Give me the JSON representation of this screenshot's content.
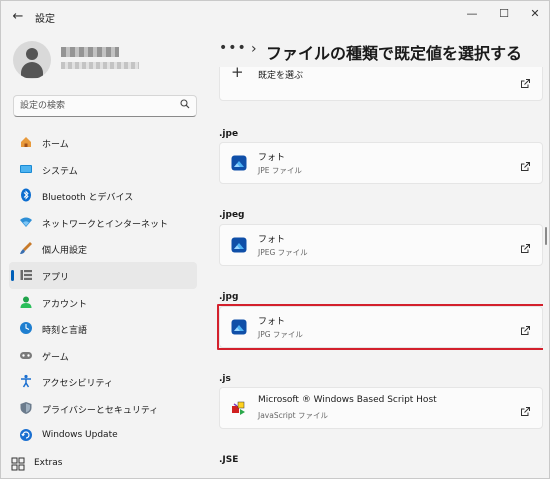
{
  "window": {
    "app_title": "設定",
    "back_icon": "←",
    "minimize_icon": "—",
    "maximize_icon": "☐",
    "close_icon": "✕"
  },
  "search": {
    "placeholder": "設定の検索"
  },
  "sidebar": {
    "items": [
      {
        "label": "ホーム",
        "icon": "home-icon"
      },
      {
        "label": "システム",
        "icon": "system-icon"
      },
      {
        "label": "Bluetooth とデバイス",
        "icon": "bluetooth-icon"
      },
      {
        "label": "ネットワークとインターネット",
        "icon": "network-icon"
      },
      {
        "label": "個人用設定",
        "icon": "personalization-icon"
      },
      {
        "label": "アプリ",
        "icon": "apps-icon",
        "selected": true
      },
      {
        "label": "アカウント",
        "icon": "account-icon"
      },
      {
        "label": "時刻と言語",
        "icon": "time-language-icon"
      },
      {
        "label": "ゲーム",
        "icon": "gaming-icon"
      },
      {
        "label": "アクセシビリティ",
        "icon": "accessibility-icon"
      },
      {
        "label": "プライバシーとセキュリティ",
        "icon": "privacy-icon"
      },
      {
        "label": "Windows Update",
        "icon": "windows-update-icon"
      }
    ],
    "extras_label": "Extras"
  },
  "breadcrumb": {
    "more": "•••",
    "chevron": "›",
    "title": "ファイルの種類で既定値を選択する"
  },
  "main": {
    "choose_default_label": "既定を選ぶ",
    "sections": [
      {
        "ext": ".jpe",
        "app": "フォト",
        "type": "JPE ファイル"
      },
      {
        "ext": ".jpeg",
        "app": "フォト",
        "type": "JPEG ファイル"
      },
      {
        "ext": ".jpg",
        "app": "フォト",
        "type": "JPG ファイル",
        "highlighted": true
      },
      {
        "ext": ".js",
        "app": "Microsoft ® Windows Based Script Host",
        "type": "JavaScript ファイル"
      }
    ],
    "next_ext": ".JSE"
  },
  "colors": {
    "accent": "#005fb8",
    "highlight": "#d3202c",
    "background": "#f3f3f3"
  }
}
